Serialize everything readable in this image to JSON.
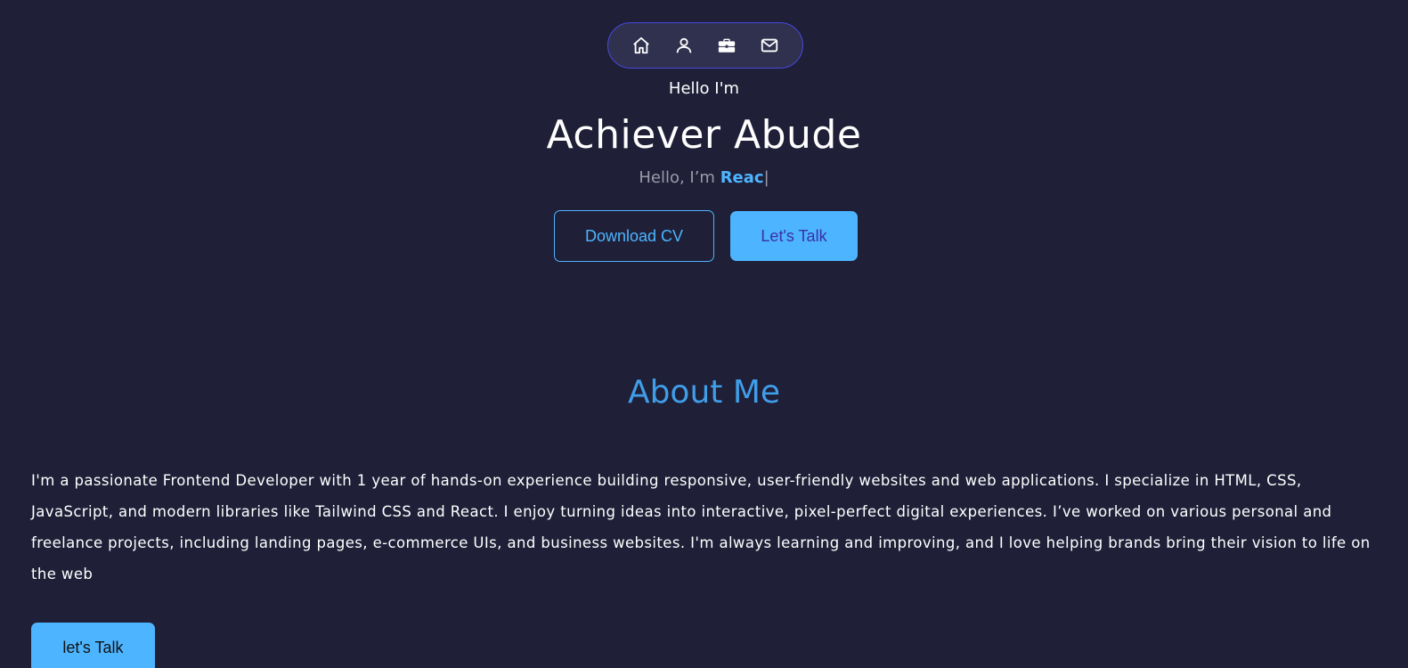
{
  "nav": {
    "items": [
      {
        "icon": "home-icon"
      },
      {
        "icon": "user-icon"
      },
      {
        "icon": "briefcase-icon"
      },
      {
        "icon": "mail-icon"
      }
    ]
  },
  "hero": {
    "greeting": "Hello I'm",
    "name": "Achiever Abude",
    "typed_prefix": "Hello, I’m ",
    "typed_role": "Reac",
    "typed_cursor": "|",
    "download_cv_label": "Download CV",
    "lets_talk_label": "Let's Talk"
  },
  "about": {
    "title": "About Me",
    "body": "I'm a passionate Frontend Developer with 1 year of hands-on experience building responsive, user-friendly websites and web applications. I specialize in HTML, CSS, JavaScript, and modern libraries like Tailwind CSS and React. I enjoy turning ideas into interactive, pixel-perfect digital experiences. I’ve worked on various personal and freelance projects, including landing pages, e-commerce UIs, and business websites. I'm always learning and improving, and I love helping brands bring their vision to life on the web",
    "talk_label": "let's Talk"
  },
  "colors": {
    "background": "#1f1f38",
    "accent": "#4db5ff",
    "nav_border": "#4848e0",
    "about_title": "#3f9ee8"
  }
}
